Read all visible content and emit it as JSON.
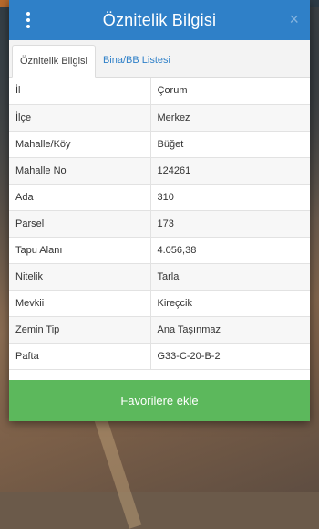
{
  "dialog": {
    "title": "Öznitelik Bilgisi",
    "close_glyph": "×",
    "menu_icon": "vertical-ellipsis-icon"
  },
  "tabs": [
    {
      "label": "Öznitelik Bilgisi",
      "active": true
    },
    {
      "label": "Bina/BB Listesi",
      "active": false
    }
  ],
  "attributes": [
    {
      "key": "İl",
      "value": "Çorum"
    },
    {
      "key": "İlçe",
      "value": "Merkez"
    },
    {
      "key": "Mahalle/Köy",
      "value": "Büğet"
    },
    {
      "key": "Mahalle No",
      "value": "124261"
    },
    {
      "key": "Ada",
      "value": "310"
    },
    {
      "key": "Parsel",
      "value": "173"
    },
    {
      "key": "Tapu Alanı",
      "value": "4.056,38"
    },
    {
      "key": "Nitelik",
      "value": "Tarla"
    },
    {
      "key": "Mevkii",
      "value": "Kireçcik"
    },
    {
      "key": "Zemin Tip",
      "value": "Ana Taşınmaz"
    },
    {
      "key": "Pafta",
      "value": "G33-C-20-B-2"
    }
  ],
  "footer": {
    "favorite_label": "Favorilere ekle"
  },
  "colors": {
    "header": "#2f80c8",
    "tab_link": "#2f80c8",
    "favorite_button": "#5cb85c"
  }
}
